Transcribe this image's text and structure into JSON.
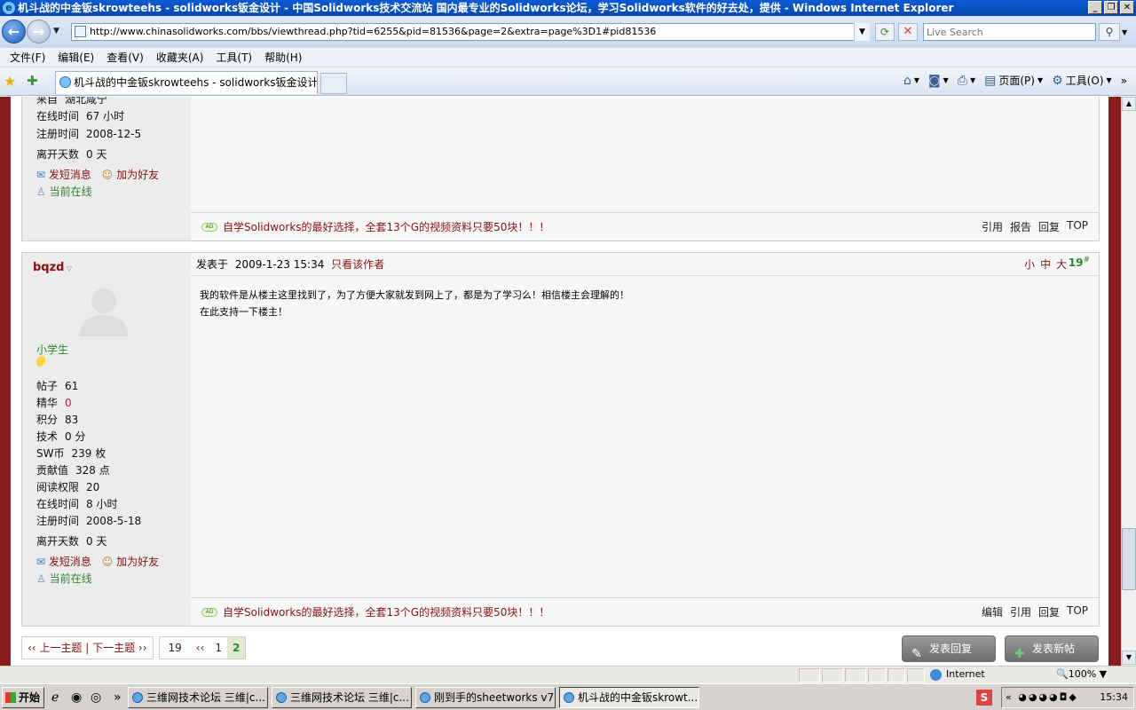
{
  "window": {
    "title": "机斗战的中金钣skrowteehs - solidworks钣金设计 - 中国Solidworks技术交流站 国内最专业的Solidworks论坛，学习Solidworks软件的好去处，提供 - Windows Internet Explorer"
  },
  "address": {
    "url": "http://www.chinasolidworks.com/bbs/viewthread.php?tid=6255&pid=81536&page=2&extra=page%3D1#pid81536",
    "search_placeholder": "Live Search"
  },
  "menu": [
    "文件(F)",
    "编辑(E)",
    "查看(V)",
    "收藏夹(A)",
    "工具(T)",
    "帮助(H)"
  ],
  "tab": {
    "label": "机斗战的中金钣skrowteehs - solidworks钣金设计 - ..."
  },
  "commandbar": {
    "page_label": "页面(P)",
    "tools_label": "工具(O)"
  },
  "post1": {
    "from_k": "来自",
    "from_v": "湖北咸宁",
    "online_k": "在线时间",
    "online_v": "67 小时",
    "reg_k": "注册时间",
    "reg_v": "2008-12-5",
    "away_k": "离开天数",
    "away_v": "0 天",
    "msg": "发短消息",
    "friend": "加为好友",
    "status": "当前在线",
    "ad": "自学Solidworks的最好选择，全套13个G的视频资料只要50块！！！",
    "actions": [
      "引用",
      "报告",
      "回复",
      "TOP"
    ]
  },
  "post2": {
    "username": "bqzd",
    "rank": "小学生",
    "stats": [
      {
        "k": "帖子",
        "v": "61"
      },
      {
        "k": "精华",
        "v": "0"
      },
      {
        "k": "积分",
        "v": "83"
      },
      {
        "k": "技术",
        "v": "0 分"
      },
      {
        "k": "SW币",
        "v": "239 枚"
      },
      {
        "k": "贡献值",
        "v": "328 点"
      },
      {
        "k": "阅读权限",
        "v": "20"
      },
      {
        "k": "在线时间",
        "v": "8 小时"
      },
      {
        "k": "注册时间",
        "v": "2008-5-18"
      },
      {
        "k": "离开天数",
        "v": "0 天"
      }
    ],
    "msg": "发短消息",
    "friend": "加为好友",
    "status": "当前在线",
    "posted_label": "发表于",
    "posted_time": "2009-1-23 15:34",
    "only_author": "只看该作者",
    "sizes": [
      "小",
      "中",
      "大"
    ],
    "floor": "19",
    "floor_mark": "#",
    "body_line1": "我的软件是从楼主这里找到了，为了方便大家就发到网上了，都是为了学习么！相信楼主会理解的！",
    "body_line2": "在此支持一下楼主！",
    "ad": "自学Solidworks的最好选择，全套13个G的视频资料只要50块！！！",
    "actions": [
      "编辑",
      "引用",
      "回复",
      "TOP"
    ]
  },
  "pager": {
    "prevnext": "‹‹ 上一主题 | 下一主题 ››",
    "total": "19",
    "prev": "‹‹",
    "pages": [
      "1",
      "2"
    ],
    "current": "2"
  },
  "buttons": {
    "reply": "发表回复",
    "newpost": "发表新帖"
  },
  "status": {
    "zone": "Internet",
    "zoom": "100%"
  },
  "taskbar": {
    "start": "开始",
    "tasks": [
      "三维网技术论坛 三维|c...",
      "三维网技术论坛 三维|c...",
      "刚到手的sheetworks v7...",
      "机斗战的中金钣skrowt..."
    ],
    "clock": "15:34"
  }
}
